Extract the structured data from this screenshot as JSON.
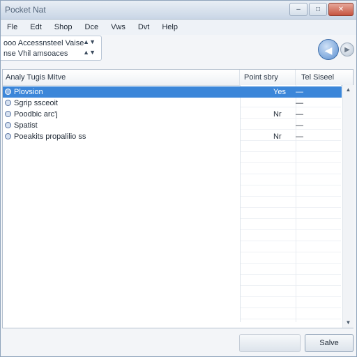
{
  "window": {
    "title": "Pocket Nat",
    "controls": {
      "minimize": "–",
      "maximize": "□",
      "close": "✕"
    }
  },
  "menu": [
    "Fle",
    "Edt",
    "Shop",
    "Dce",
    "Vws",
    "Dvt",
    "Help"
  ],
  "toolbar": {
    "rows": [
      {
        "text": "ooo Accessnsteel Vaise",
        "spin": "▲▼"
      },
      {
        "text": "nse Vhil amsoaces",
        "spin": "▲▼"
      }
    ]
  },
  "nav": {
    "back_glyph": "◀",
    "forward_glyph": "▶"
  },
  "list": {
    "columns": [
      "Analy Tugis Mitve",
      "Point sbry",
      "Tel Siseel"
    ],
    "rows": [
      {
        "name": "Plovsion",
        "c2": "Yes",
        "c3": "—",
        "selected": true
      },
      {
        "name": "Sgrip ssceoit",
        "c2": "",
        "c3": "—",
        "selected": false
      },
      {
        "name": "Poodbic arc'j",
        "c2": "Nr",
        "c3": "—",
        "selected": false
      },
      {
        "name": "Spatist",
        "c2": "",
        "c3": "—",
        "selected": false
      },
      {
        "name": "Poeakits propalilio ss",
        "c2": "Nr",
        "c3": "—",
        "selected": false
      }
    ]
  },
  "buttons": {
    "secondary": "",
    "primary": "Salve"
  }
}
